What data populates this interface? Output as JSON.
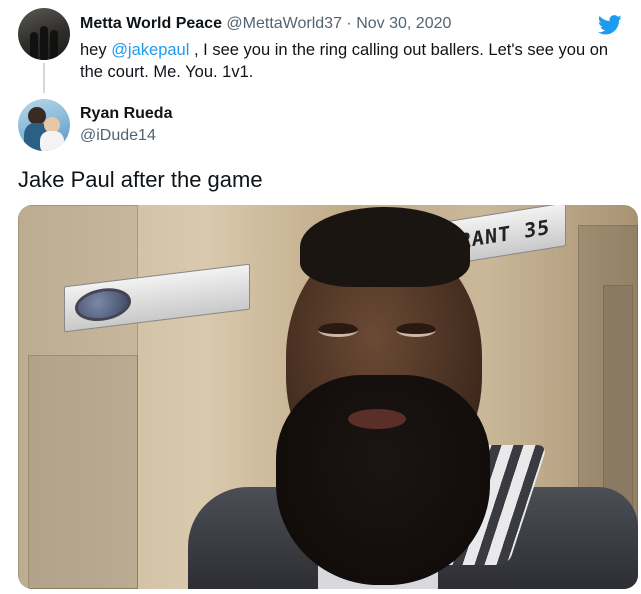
{
  "quoted_tweet": {
    "author_name": "Metta World Peace",
    "author_handle": "@MettaWorld37",
    "separator": "·",
    "date": "Nov 30, 2020",
    "text_before": "hey ",
    "mention": "@jakepaul",
    "text_after": " , I see you in the ring calling out ballers. Let's see you on the court. Me. You. 1v1."
  },
  "tweet": {
    "author_name": "Ryan Rueda",
    "author_handle": "@iDude14",
    "caption": "Jake Paul after the game"
  },
  "photo": {
    "nameplate_text": "URANT 35"
  },
  "icons": {
    "brand": "twitter-bird-icon"
  },
  "colors": {
    "link": "#1d9bf0",
    "secondary_text": "#536471",
    "thread_line": "#cfd9de",
    "twitter_blue": "#1d9bf0"
  }
}
